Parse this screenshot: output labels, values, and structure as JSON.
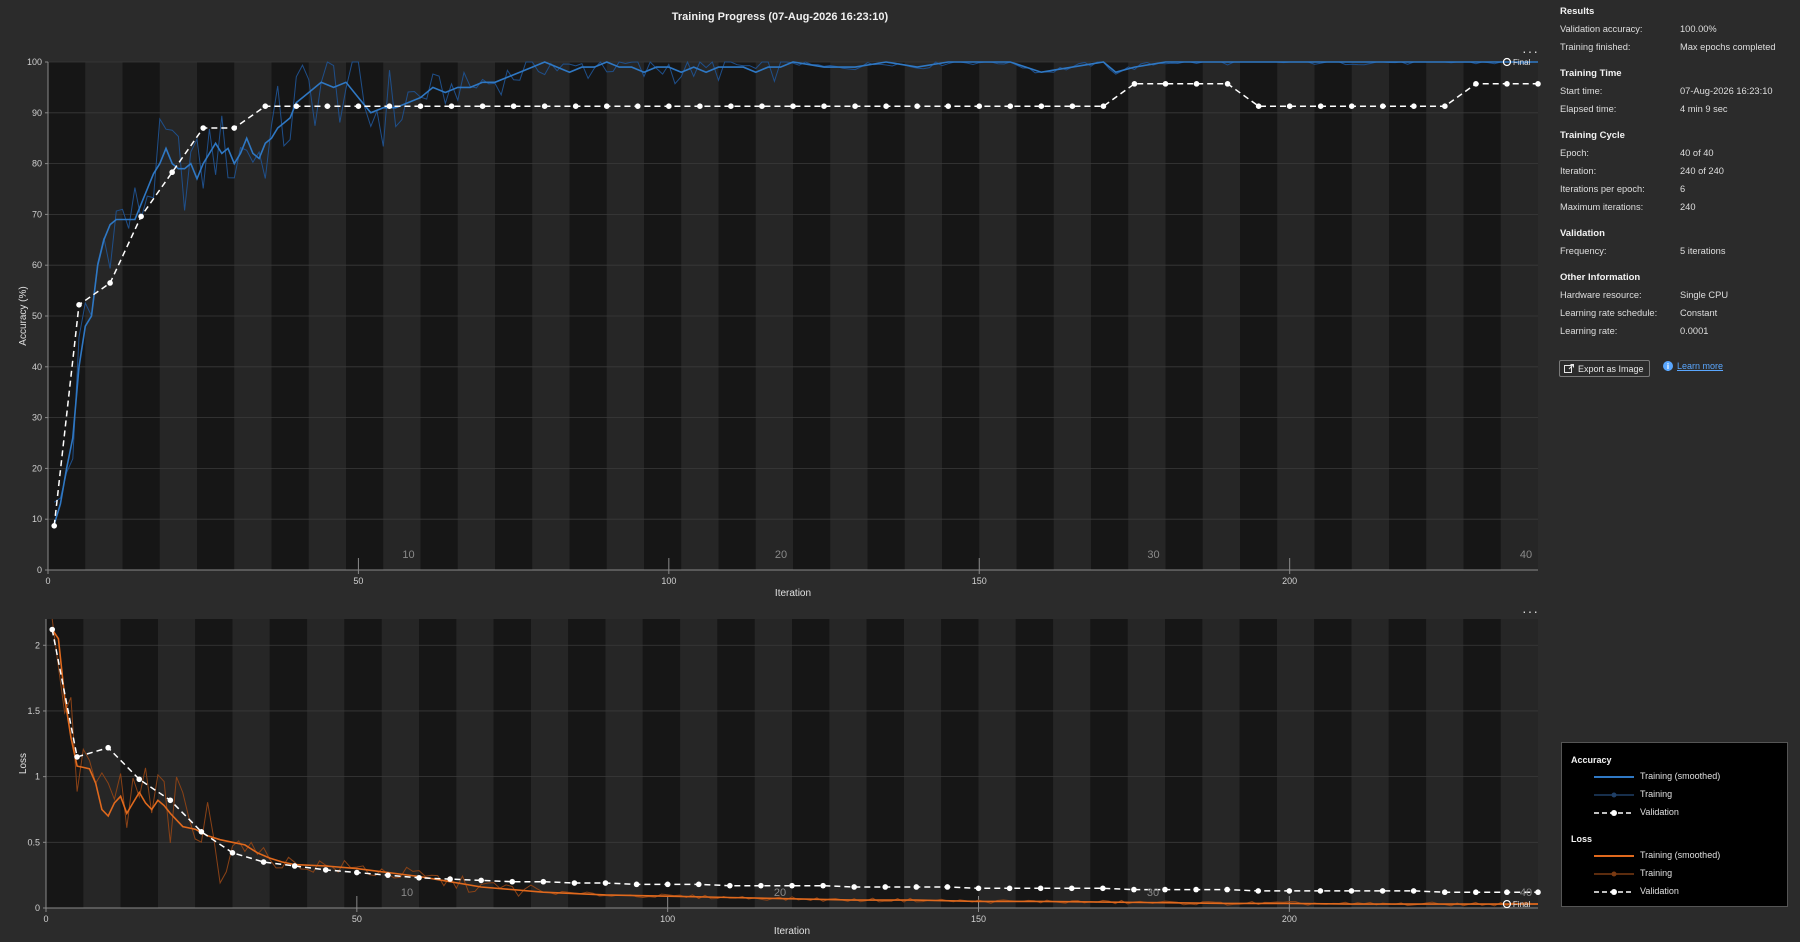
{
  "title": "Training Progress (07-Aug-2026 16:23:10)",
  "colors": {
    "background": "#2b2b2b",
    "accuracy": "#2f78c4",
    "loss": "#e0691d",
    "validation": "#ffffff"
  },
  "menu_icon": "more-icon",
  "panel": {
    "results": {
      "heading": "Results",
      "rows": [
        {
          "label": "Validation accuracy:",
          "value": "100.00%"
        },
        {
          "label": "Training finished:",
          "value": "Max epochs completed"
        }
      ]
    },
    "training_time": {
      "heading": "Training Time",
      "rows": [
        {
          "label": "Start time:",
          "value": "07-Aug-2026 16:23:10"
        },
        {
          "label": "Elapsed time:",
          "value": "4 min 9 sec"
        }
      ]
    },
    "training_cycle": {
      "heading": "Training Cycle",
      "rows": [
        {
          "label": "Epoch:",
          "value": "40 of 40"
        },
        {
          "label": "Iteration:",
          "value": "240 of 240"
        },
        {
          "label": "Iterations per epoch:",
          "value": "6"
        },
        {
          "label": "Maximum iterations:",
          "value": "240"
        }
      ]
    },
    "validation": {
      "heading": "Validation",
      "rows": [
        {
          "label": "Frequency:",
          "value": "5 iterations"
        }
      ]
    },
    "other": {
      "heading": "Other Information",
      "rows": [
        {
          "label": "Hardware resource:",
          "value": "Single CPU"
        },
        {
          "label": "Learning rate schedule:",
          "value": "Constant"
        },
        {
          "label": "Learning rate:",
          "value": "0.0001"
        }
      ]
    },
    "export_label": "Export as Image",
    "learn_more_label": "Learn more"
  },
  "legend": {
    "accuracy_title": "Accuracy",
    "loss_title": "Loss",
    "items": [
      "Training (smoothed)",
      "Training",
      "Validation"
    ]
  },
  "chart_data": [
    {
      "type": "line",
      "ylabel": "Accuracy (%)",
      "xlabel": "Iteration",
      "xlim": [
        0,
        240
      ],
      "ylim": [
        0,
        100
      ],
      "xticks": [
        0,
        50,
        100,
        150,
        200
      ],
      "yticks": [
        0,
        10,
        20,
        30,
        40,
        50,
        60,
        70,
        80,
        90,
        100
      ],
      "epoch_labels": [
        10,
        20,
        30,
        40
      ],
      "epochs": 40,
      "iterations_per_epoch": 6,
      "final_label": "Final",
      "series": [
        {
          "name": "Training (smoothed)",
          "x": [
            1,
            2,
            3,
            4,
            5,
            6,
            7,
            8,
            9,
            10,
            11,
            12,
            13,
            14,
            15,
            16,
            17,
            18,
            19,
            20,
            21,
            22,
            23,
            24,
            25,
            26,
            27,
            28,
            29,
            30,
            31,
            32,
            33,
            34,
            35,
            36,
            37,
            38,
            39,
            40,
            42,
            44,
            46,
            48,
            50,
            52,
            54,
            56,
            58,
            60,
            62,
            64,
            66,
            68,
            70,
            72,
            74,
            76,
            78,
            80,
            82,
            84,
            86,
            88,
            90,
            92,
            94,
            96,
            98,
            100,
            102,
            104,
            106,
            108,
            110,
            112,
            114,
            116,
            118,
            120,
            125,
            130,
            135,
            140,
            145,
            150,
            155,
            160,
            165,
            170,
            172,
            175,
            180,
            185,
            190,
            200,
            210,
            220,
            230,
            240
          ],
          "values": [
            9,
            13,
            20,
            26,
            40,
            48,
            50,
            60,
            65,
            68,
            69,
            69,
            69,
            69,
            72,
            75,
            78,
            80,
            83,
            80,
            79,
            79,
            80,
            77,
            80,
            82,
            84,
            82,
            83,
            80,
            82,
            85,
            82,
            81,
            84,
            85,
            87,
            88,
            89,
            92,
            94,
            96,
            95,
            96,
            93,
            90,
            91,
            91,
            92,
            93,
            95,
            94,
            95,
            95,
            96,
            96,
            97,
            98,
            99,
            100,
            99,
            98,
            99,
            99,
            100,
            99,
            99,
            98,
            99,
            99,
            98,
            99,
            98,
            99,
            99,
            99,
            98,
            99,
            99,
            100,
            99,
            99,
            100,
            99,
            100,
            100,
            100,
            98,
            99,
            100,
            98,
            99,
            100,
            100,
            100,
            100,
            100,
            100,
            100,
            100
          ]
        },
        {
          "name": "Validation",
          "x": [
            1,
            5,
            10,
            15,
            20,
            25,
            30,
            35,
            40,
            45,
            50,
            55,
            60,
            65,
            70,
            75,
            80,
            85,
            90,
            95,
            100,
            105,
            110,
            115,
            120,
            125,
            130,
            135,
            140,
            145,
            150,
            155,
            160,
            165,
            170,
            175,
            180,
            185,
            190,
            195,
            200,
            205,
            210,
            215,
            220,
            225,
            230,
            235,
            240
          ],
          "values": [
            8.7,
            52.2,
            56.5,
            69.6,
            78.3,
            87,
            87,
            91.3,
            91.3,
            91.3,
            91.3,
            91.3,
            91.3,
            91.3,
            91.3,
            91.3,
            91.3,
            91.3,
            91.3,
            91.3,
            91.3,
            91.3,
            91.3,
            91.3,
            91.3,
            91.3,
            91.3,
            91.3,
            91.3,
            91.3,
            91.3,
            91.3,
            91.3,
            91.3,
            91.3,
            95.7,
            95.7,
            95.7,
            95.7,
            91.3,
            91.3,
            91.3,
            91.3,
            91.3,
            91.3,
            91.3,
            95.7,
            95.7,
            95.7
          ]
        }
      ]
    },
    {
      "type": "line",
      "ylabel": "Loss",
      "xlabel": "Iteration",
      "xlim": [
        0,
        240
      ],
      "ylim": [
        0,
        2.2
      ],
      "xticks": [
        0,
        50,
        100,
        150,
        200
      ],
      "yticks": [
        0,
        0.5,
        1,
        1.5,
        2
      ],
      "epoch_labels": [
        10,
        20,
        30,
        40
      ],
      "epochs": 40,
      "iterations_per_epoch": 6,
      "final_label": "Final",
      "series": [
        {
          "name": "Training (smoothed)",
          "x": [
            1,
            2,
            3,
            4,
            5,
            6,
            7,
            8,
            9,
            10,
            11,
            12,
            13,
            14,
            15,
            16,
            17,
            18,
            19,
            20,
            22,
            24,
            26,
            28,
            30,
            32,
            34,
            36,
            38,
            40,
            45,
            50,
            55,
            60,
            65,
            70,
            75,
            80,
            90,
            100,
            110,
            120,
            130,
            140,
            150,
            160,
            170,
            180,
            190,
            200,
            210,
            220,
            230,
            240
          ],
          "values": [
            2.12,
            2.05,
            1.6,
            1.3,
            1.08,
            1.07,
            1.06,
            0.95,
            0.75,
            0.7,
            0.8,
            0.85,
            0.72,
            0.8,
            0.88,
            0.8,
            0.75,
            0.82,
            0.78,
            0.72,
            0.62,
            0.6,
            0.55,
            0.52,
            0.5,
            0.48,
            0.42,
            0.38,
            0.35,
            0.33,
            0.32,
            0.3,
            0.27,
            0.24,
            0.2,
            0.16,
            0.14,
            0.12,
            0.1,
            0.09,
            0.08,
            0.07,
            0.06,
            0.06,
            0.05,
            0.05,
            0.045,
            0.04,
            0.035,
            0.035,
            0.03,
            0.03,
            0.03,
            0.03
          ]
        },
        {
          "name": "Validation",
          "x": [
            1,
            5,
            10,
            15,
            20,
            25,
            30,
            35,
            40,
            45,
            50,
            55,
            60,
            65,
            70,
            75,
            80,
            85,
            90,
            95,
            100,
            105,
            110,
            115,
            120,
            125,
            130,
            135,
            140,
            145,
            150,
            155,
            160,
            165,
            170,
            175,
            180,
            185,
            190,
            195,
            200,
            205,
            210,
            215,
            220,
            225,
            230,
            235,
            240
          ],
          "values": [
            2.12,
            1.15,
            1.22,
            0.98,
            0.82,
            0.58,
            0.42,
            0.35,
            0.32,
            0.29,
            0.27,
            0.25,
            0.23,
            0.22,
            0.21,
            0.2,
            0.2,
            0.19,
            0.19,
            0.18,
            0.18,
            0.18,
            0.17,
            0.17,
            0.17,
            0.17,
            0.16,
            0.16,
            0.16,
            0.16,
            0.15,
            0.15,
            0.15,
            0.15,
            0.15,
            0.14,
            0.14,
            0.14,
            0.14,
            0.13,
            0.13,
            0.13,
            0.13,
            0.13,
            0.13,
            0.12,
            0.12,
            0.12,
            0.12
          ]
        }
      ]
    }
  ]
}
